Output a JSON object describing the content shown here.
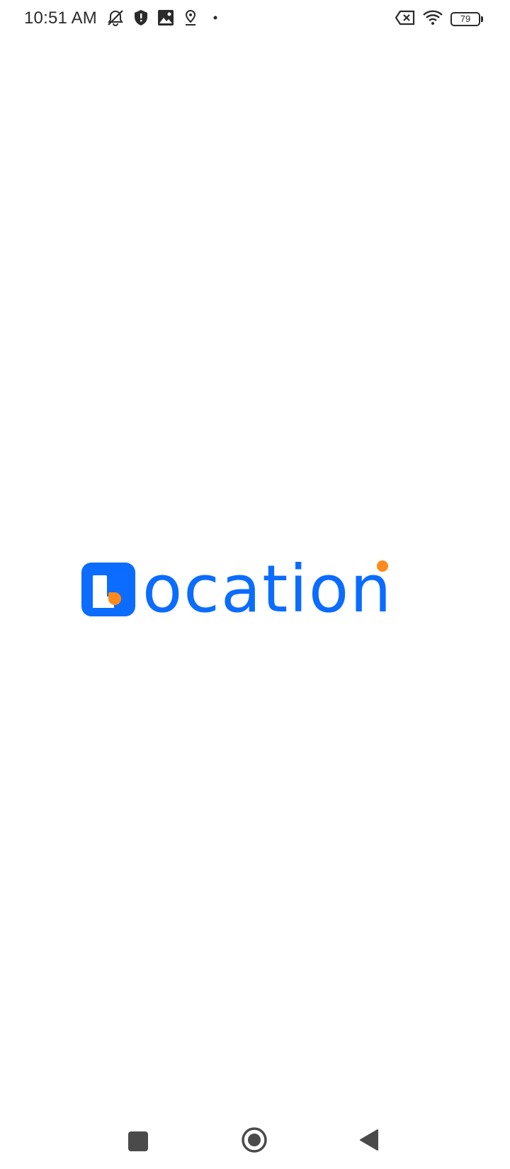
{
  "status_bar": {
    "time": "10:51 AM",
    "battery_level": "79",
    "left_icons": [
      "muted-bell-icon",
      "shield-icon",
      "image-icon",
      "location-pin-icon",
      "dot-icon"
    ],
    "right_icons": [
      "sim-error-icon",
      "wifi-icon",
      "battery-icon"
    ]
  },
  "splash": {
    "logo_text": "ocation",
    "colors": {
      "brand_blue": "#0b6cff",
      "accent_orange": "#ff8a1c"
    }
  },
  "nav_bar": {
    "buttons": [
      "recent-apps",
      "home",
      "back"
    ]
  }
}
